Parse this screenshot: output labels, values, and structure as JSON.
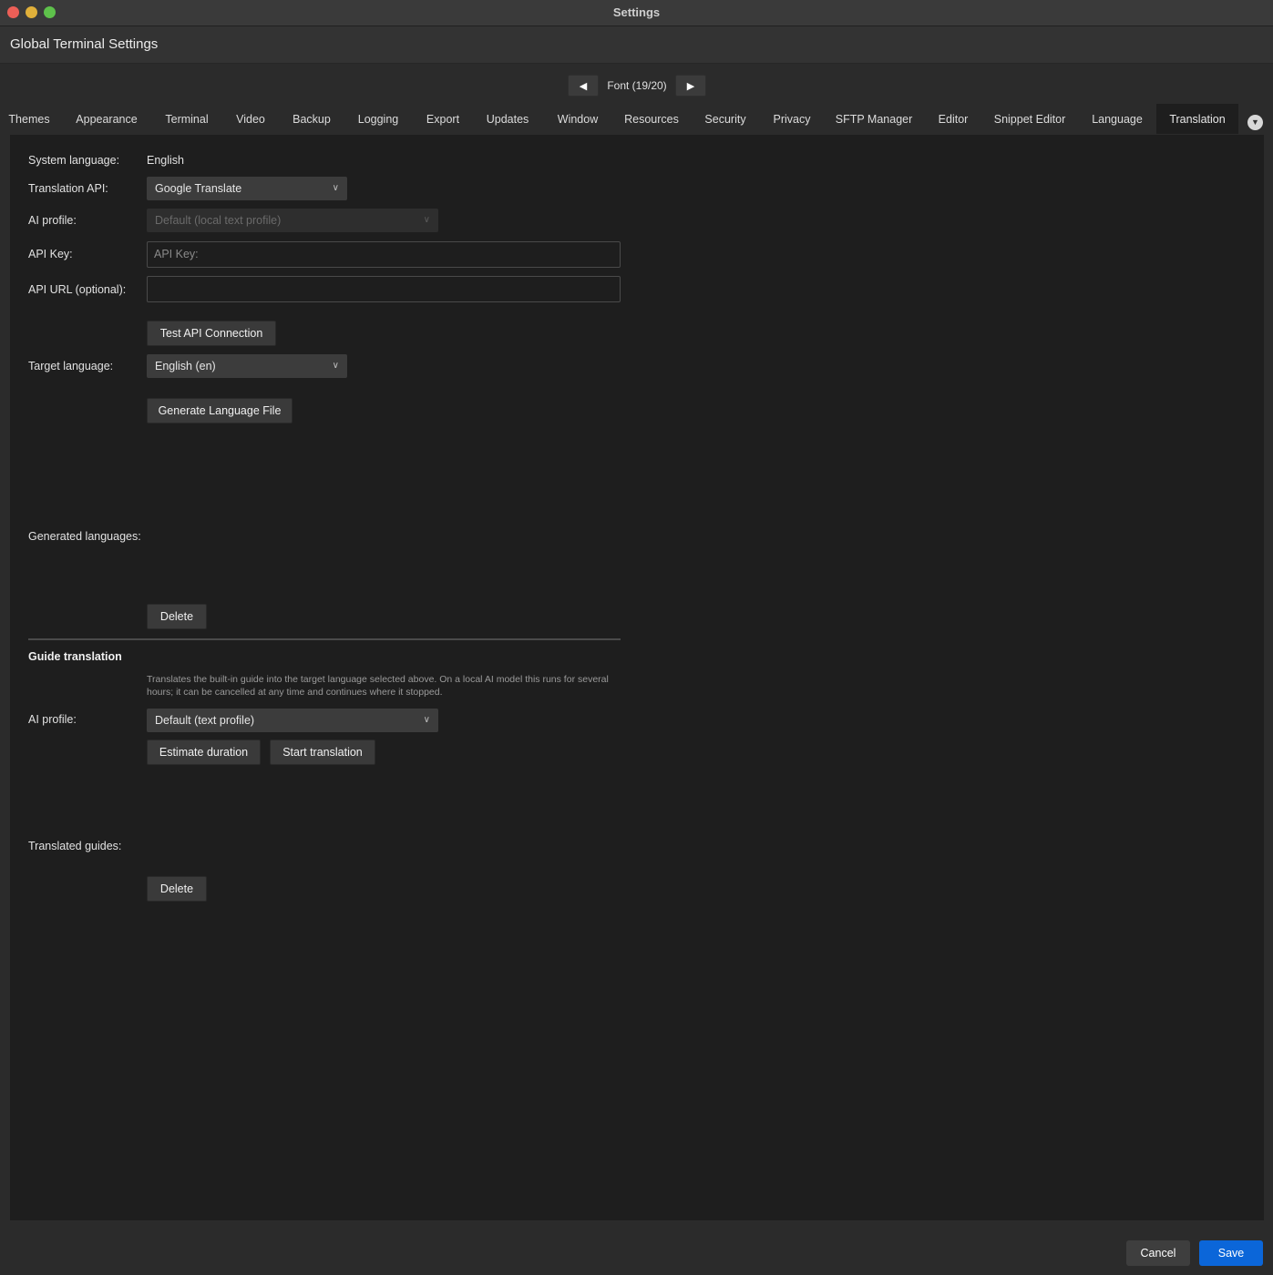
{
  "window": {
    "title": "Settings"
  },
  "header": {
    "title": "Global Terminal Settings"
  },
  "pager": {
    "prev_icon": "◀",
    "label": "Font (19/20)",
    "next_icon": "▶"
  },
  "tabs": [
    {
      "label": "Themes"
    },
    {
      "label": "Appearance"
    },
    {
      "label": "Terminal"
    },
    {
      "label": "Video"
    },
    {
      "label": "Backup"
    },
    {
      "label": "Logging"
    },
    {
      "label": "Export"
    },
    {
      "label": "Updates"
    },
    {
      "label": "Window"
    },
    {
      "label": "Resources"
    },
    {
      "label": "Security"
    },
    {
      "label": "Privacy"
    },
    {
      "label": "SFTP Manager"
    },
    {
      "label": "Editor"
    },
    {
      "label": "Snippet Editor"
    },
    {
      "label": "Language"
    },
    {
      "label": "Translation"
    }
  ],
  "active_tab": "Translation",
  "form": {
    "system_language_label": "System language:",
    "system_language_value": "English",
    "translation_api_label": "Translation API:",
    "translation_api_value": "Google Translate",
    "ai_profile_label": "AI profile:",
    "ai_profile_value": "Default (local text profile)",
    "api_key_label": "API Key:",
    "api_key_placeholder": "API Key:",
    "api_url_label": "API URL (optional):",
    "api_url_value": "",
    "test_button": "Test API Connection",
    "target_language_label": "Target language:",
    "target_language_value": "English (en)",
    "generate_button": "Generate Language File",
    "generated_languages_label": "Generated languages:",
    "delete_button": "Delete"
  },
  "guide": {
    "title": "Guide translation",
    "hint": "Translates the built-in guide into the target language selected above. On a local AI model this runs for several hours; it can be cancelled at any time and continues where it stopped.",
    "ai_profile_label": "AI profile:",
    "ai_profile_value": "Default (text profile)",
    "estimate_button": "Estimate duration",
    "start_button": "Start translation",
    "translated_guides_label": "Translated guides:",
    "delete_button": "Delete"
  },
  "footer": {
    "cancel": "Cancel",
    "save": "Save"
  },
  "colors": {
    "accent": "#0b66d9",
    "panel": "#1e1e1e",
    "chrome": "#2b2b2b"
  }
}
